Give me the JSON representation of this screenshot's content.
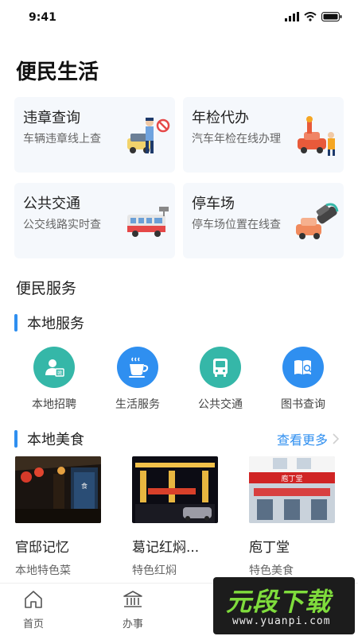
{
  "status_bar": {
    "time": "9:41"
  },
  "page_title": "便民生活",
  "cards": [
    {
      "title": "违章查询",
      "subtitle": "车辆违章线上查",
      "icon": "traffic-police-icon"
    },
    {
      "title": "年检代办",
      "subtitle": "汽车年检在线办理",
      "icon": "car-repair-icon"
    },
    {
      "title": "公共交通",
      "subtitle": "公交线路实时查",
      "icon": "bus-icon"
    },
    {
      "title": "停车场",
      "subtitle": "停车场位置在线查",
      "icon": "parking-icon"
    }
  ],
  "services_section": {
    "title": "便民服务"
  },
  "local_services": {
    "title": "本地服务",
    "items": [
      {
        "label": "本地招聘",
        "icon": "recruit-icon",
        "color": "#35b7a8"
      },
      {
        "label": "生活服务",
        "icon": "coffee-icon",
        "color": "#2f8ff0"
      },
      {
        "label": "公共交通",
        "icon": "bus-icon",
        "color": "#35b7a8"
      },
      {
        "label": "图书查询",
        "icon": "book-search-icon",
        "color": "#2f8ff0"
      }
    ]
  },
  "local_food": {
    "title": "本地美食",
    "more_label": "查看更多",
    "items": [
      {
        "name": "官邸记忆",
        "desc": "本地特色菜"
      },
      {
        "name": "葛记红焖...",
        "desc": "特色红焖"
      },
      {
        "name": "庖丁堂",
        "desc": "特色美食"
      }
    ]
  },
  "tabbar": {
    "items": [
      {
        "label": "首页",
        "icon": "home-icon"
      },
      {
        "label": "办事",
        "icon": "bank-icon"
      }
    ]
  },
  "watermark": {
    "main": "元段下载",
    "url": "www.yuanpi.com"
  },
  "colors": {
    "accent": "#2f8ff0",
    "teal": "#35b7a8",
    "card_bg": "#f5f8fc"
  }
}
